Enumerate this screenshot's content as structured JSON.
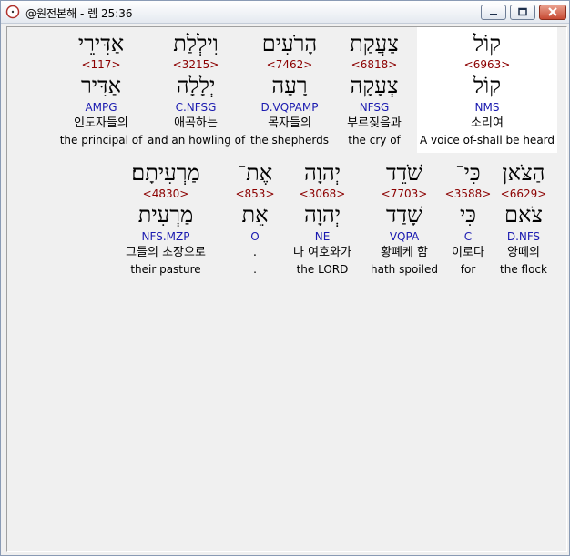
{
  "window": {
    "title": "@원전본해 - 렘 25:36",
    "buttons": {
      "minimize": "minimize",
      "maximize": "maximize",
      "close": "close"
    }
  },
  "rows": [
    {
      "words": [
        {
          "hebrew": "אַדִּירֵי",
          "strong": "<117>",
          "lemma": "אַדִּיר",
          "parse": "AMPG",
          "korean": "인도자들의",
          "english": "the principal of"
        },
        {
          "hebrew": "וִילְלַת",
          "strong": "<3215>",
          "lemma": "יְלָלָה",
          "parse": "C.NFSG",
          "korean": "애곡하는",
          "english": "and an howling of"
        },
        {
          "hebrew": "הָרֹעִים",
          "strong": "<7462>",
          "lemma": "רָעָה",
          "parse": "D.VQPAMP",
          "korean": "목자들의",
          "english": "the shepherds"
        },
        {
          "hebrew": "צַעֲקַת",
          "strong": "<6818>",
          "lemma": "צְעָקָה",
          "parse": "NFSG",
          "korean": "부르짖음과",
          "english": "the cry of"
        },
        {
          "hebrew": "קוֹל",
          "strong": "<6963>",
          "lemma": "קוֹל",
          "parse": "NMS",
          "korean": "소리여",
          "english": "A voice of-shall be heard"
        }
      ]
    },
    {
      "words": [
        {
          "hebrew": "מַרְעִיתָם׃",
          "strong": "<4830>",
          "lemma": "מַרְעִית",
          "parse": "NFS.MZP",
          "korean": "그들의 초장으로",
          "english": "their pasture"
        },
        {
          "hebrew": "אֶת־",
          "strong": "<853>",
          "lemma": "אֵת",
          "parse": "O",
          "korean": ".",
          "english": "."
        },
        {
          "hebrew": "יְהוָה",
          "strong": "<3068>",
          "lemma": "יְהוָה",
          "parse": "NE",
          "korean": "나 여호와가",
          "english": "the LORD"
        },
        {
          "hebrew": "שֹׁדֵד",
          "strong": "<7703>",
          "lemma": "שָׁדַד",
          "parse": "VQPA",
          "korean": "황폐케 함",
          "english": "hath spoiled"
        },
        {
          "hebrew": "כִּי־",
          "strong": "<3588>",
          "lemma": "כִּי",
          "parse": "C",
          "korean": "이로다",
          "english": "for"
        },
        {
          "hebrew": "הַצֹּאן",
          "strong": "<6629>",
          "lemma": "צֹאם",
          "parse": "D.NFS",
          "korean": "양떼의",
          "english": "the flock"
        }
      ]
    }
  ],
  "colors": {
    "strong": "#8b0000",
    "parse": "#1a1ab0",
    "highlight": "#ffffff",
    "background": "#f0f0f0"
  }
}
